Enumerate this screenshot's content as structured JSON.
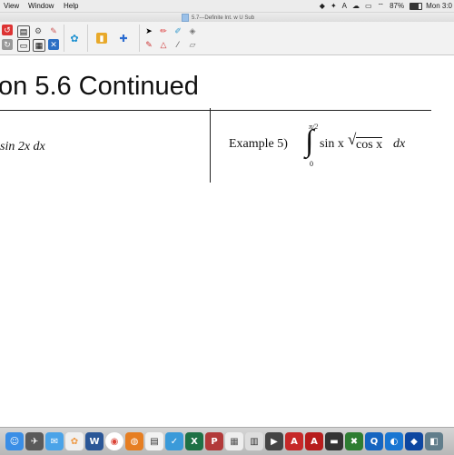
{
  "menubar": {
    "items": [
      "View",
      "Window",
      "Help"
    ],
    "battery": "87%",
    "clock": "Mon 3:0"
  },
  "window": {
    "document_title": "5.7---Definite Int. w U Sub"
  },
  "slide": {
    "title": "on 5.6 Continued",
    "left_integral": "sin 2x dx",
    "example_label": "Example 5)",
    "integral_sign": "∫",
    "upper_limit": "π/2",
    "lower_limit": "0",
    "integrand": "sin x",
    "radical": "√",
    "radicand": "cos x",
    "differential": "dx"
  },
  "dock": {
    "icons": [
      "finder-icon",
      "launchpad-icon",
      "mail-icon",
      "photos-icon",
      "word-icon",
      "chrome-icon",
      "safari-icon",
      "notes-icon",
      "excel-icon",
      "app-icon",
      "books-icon",
      "acrobat-icon",
      "app2-icon",
      "acrobat2-icon",
      "terminal-icon",
      "smart-notebook-icon",
      "quicktime-icon",
      "globe-icon",
      "app3-icon"
    ]
  }
}
